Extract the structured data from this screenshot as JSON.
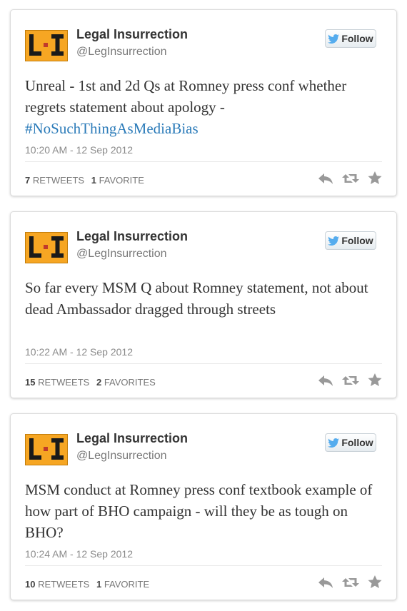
{
  "colors": {
    "link": "#2b7bb9",
    "avatar_bg": "#f6a623",
    "twitter_bird": "#55acee"
  },
  "follow_label": "Follow",
  "tweets": [
    {
      "name": "Legal Insurrection",
      "handle": "@LegInsurrection",
      "text_before": "Unreal - 1st and 2d Qs at Romney press conf whether regrets statement about apology - ",
      "hashtag": "#NoSuchThingAsMediaBias",
      "timestamp": "10:20 AM - 12 Sep 2012",
      "retweets_count": "7",
      "retweets_label": "RETWEETS",
      "favorites_count": "1",
      "favorites_label": "FAVORITE"
    },
    {
      "name": "Legal Insurrection",
      "handle": "@LegInsurrection",
      "text_before": "So far every MSM Q about Romney statement, not about dead Ambassador dragged through streets",
      "hashtag": "",
      "timestamp": "10:22 AM - 12 Sep 2012",
      "retweets_count": "15",
      "retweets_label": "RETWEETS",
      "favorites_count": "2",
      "favorites_label": "FAVORITES"
    },
    {
      "name": "Legal Insurrection",
      "handle": "@LegInsurrection",
      "text_before": "MSM conduct at Romney press conf textbook example of how part of BHO campaign - will they be as tough on BHO?",
      "hashtag": "",
      "timestamp": "10:24 AM - 12 Sep 2012",
      "retweets_count": "10",
      "retweets_label": "RETWEETS",
      "favorites_count": "1",
      "favorites_label": "FAVORITE"
    }
  ]
}
